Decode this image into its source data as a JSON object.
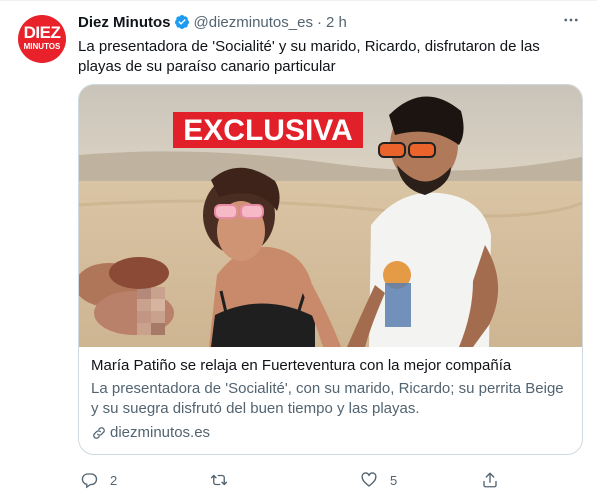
{
  "tweet": {
    "avatar_text_top": "DIEZ",
    "avatar_text_bottom": "MINUTOS",
    "name": "Diez Minutos",
    "handle": "@diezminutos_es",
    "separator": "·",
    "time": "2 h",
    "text": "La presentadora de 'Socialité' y su marido, Ricardo, disfrutaron de las playas de su paraíso canario particular"
  },
  "card": {
    "image_label": "EXCLUSIVA",
    "title": "María Patiño se relaja en Fuerteventura con la mejor compañía",
    "description": "La presentadora de 'Socialité', con su marido, Ricardo; su perrita Beige y su suegra disfrutó del buen tiempo y las playas.",
    "domain": "diezminutos.es"
  },
  "actions": {
    "reply_count": "2",
    "retweet_count": "",
    "like_count": "5",
    "share_count": ""
  },
  "icons": [
    "verified-badge-icon",
    "more-icon",
    "link-icon",
    "reply-icon",
    "retweet-icon",
    "like-icon",
    "share-icon"
  ],
  "colors": {
    "brand_red": "#e8212a",
    "verified_blue": "#1d9bf0",
    "secondary_text": "#536471",
    "primary_text": "#0f1419",
    "card_border": "#cfd9de"
  }
}
